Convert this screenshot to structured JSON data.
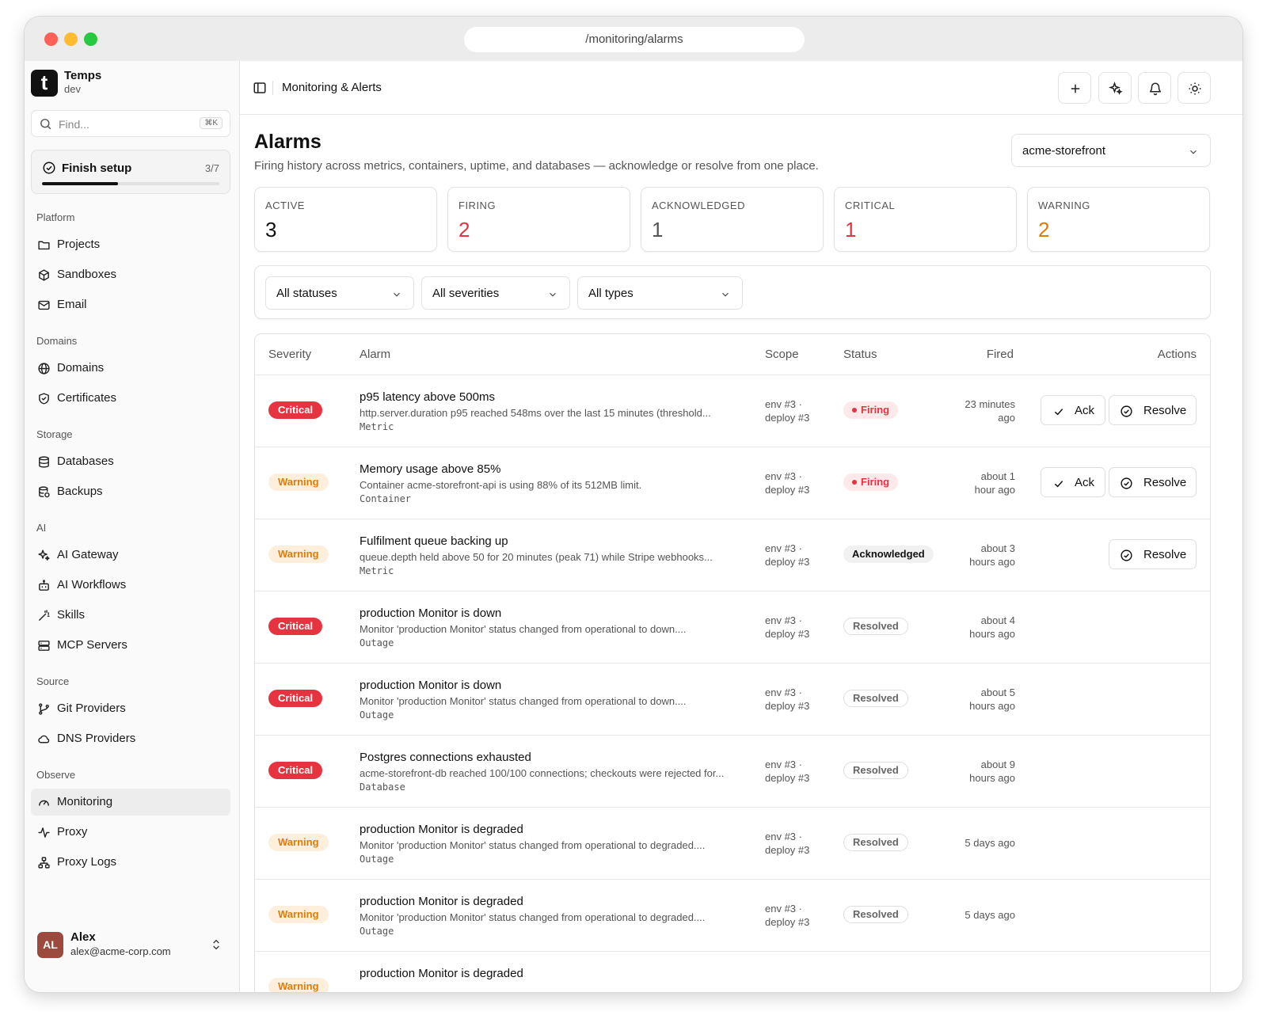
{
  "browser": {
    "url": "/monitoring/alarms"
  },
  "sidebar": {
    "brand": {
      "logo_letter": "t",
      "name": "Temps",
      "env": "dev"
    },
    "search": {
      "placeholder": "Find...",
      "shortcut": "⌘K"
    },
    "setup": {
      "label": "Finish setup",
      "count": "3/7",
      "progress": 0.43
    },
    "groups": [
      {
        "title": "Platform",
        "items": [
          {
            "label": "Projects",
            "icon": "folder-icon"
          },
          {
            "label": "Sandboxes",
            "icon": "box-icon"
          },
          {
            "label": "Email",
            "icon": "mail-icon"
          }
        ]
      },
      {
        "title": "Domains",
        "items": [
          {
            "label": "Domains",
            "icon": "globe-icon"
          },
          {
            "label": "Certificates",
            "icon": "shield-check-icon"
          }
        ]
      },
      {
        "title": "Storage",
        "items": [
          {
            "label": "Databases",
            "icon": "database-icon"
          },
          {
            "label": "Backups",
            "icon": "database-backup-icon"
          }
        ]
      },
      {
        "title": "AI",
        "items": [
          {
            "label": "AI Gateway",
            "icon": "sparkles-icon"
          },
          {
            "label": "AI Workflows",
            "icon": "bot-icon"
          },
          {
            "label": "Skills",
            "icon": "wand-icon"
          },
          {
            "label": "MCP Servers",
            "icon": "server-icon"
          }
        ]
      },
      {
        "title": "Source",
        "items": [
          {
            "label": "Git Providers",
            "icon": "git-branch-icon"
          },
          {
            "label": "DNS Providers",
            "icon": "cloud-icon"
          }
        ]
      },
      {
        "title": "Observe",
        "items": [
          {
            "label": "Monitoring",
            "icon": "gauge-icon",
            "active": true
          },
          {
            "label": "Proxy",
            "icon": "activity-icon"
          },
          {
            "label": "Proxy Logs",
            "icon": "network-icon"
          }
        ]
      }
    ],
    "user": {
      "initials": "AL",
      "name": "Alex",
      "email": "alex@acme-corp.com"
    }
  },
  "header": {
    "breadcrumb": "Monitoring & Alerts",
    "actions": [
      "plus-icon",
      "sparkles-icon",
      "bell-icon",
      "sun-icon"
    ]
  },
  "page": {
    "title": "Alarms",
    "subtitle": "Firing history across metrics, containers, uptime, and databases — acknowledge or resolve from one place.",
    "project": "acme-storefront"
  },
  "stats": [
    {
      "label": "ACTIVE",
      "value": "3",
      "color": "#111111"
    },
    {
      "label": "FIRING",
      "value": "2",
      "color": "#e5333f"
    },
    {
      "label": "ACKNOWLEDGED",
      "value": "1",
      "color": "#555555"
    },
    {
      "label": "CRITICAL",
      "value": "1",
      "color": "#e5333f"
    },
    {
      "label": "WARNING",
      "value": "2",
      "color": "#e07b0a"
    }
  ],
  "filters": {
    "status": "All statuses",
    "severity": "All severities",
    "type": "All types"
  },
  "table": {
    "columns": [
      "Severity",
      "Alarm",
      "Scope",
      "Status",
      "Fired",
      "Actions"
    ],
    "actions": {
      "ack": "Ack",
      "resolve": "Resolve"
    },
    "rows": [
      {
        "severity": "Critical",
        "sev_class": "critical",
        "title": "p95 latency above 500ms",
        "desc": "http.server.duration p95 reached 548ms over the last 15 minutes (threshold...",
        "type": "Metric",
        "scope1": "env #3 ·",
        "scope2": "deploy #3",
        "status": "Firing",
        "status_class": "firing",
        "fired1": "23 minutes",
        "fired2": "ago",
        "ack": true,
        "resolve": true
      },
      {
        "severity": "Warning",
        "sev_class": "warning",
        "title": "Memory usage above 85%",
        "desc": "Container acme-storefront-api is using 88% of its 512MB limit.",
        "type": "Container",
        "scope1": "env #3 ·",
        "scope2": "deploy #3",
        "status": "Firing",
        "status_class": "firing",
        "fired1": "about 1",
        "fired2": "hour ago",
        "ack": true,
        "resolve": true
      },
      {
        "severity": "Warning",
        "sev_class": "warning",
        "title": "Fulfilment queue backing up",
        "desc": "queue.depth held above 50 for 20 minutes (peak 71) while Stripe webhooks...",
        "type": "Metric",
        "scope1": "env #3 ·",
        "scope2": "deploy #3",
        "status": "Acknowledged",
        "status_class": "acknowledged",
        "fired1": "about 3",
        "fired2": "hours ago",
        "ack": false,
        "resolve": true
      },
      {
        "severity": "Critical",
        "sev_class": "critical",
        "title": "production Monitor is down",
        "desc": "Monitor 'production Monitor' status changed from operational to down....",
        "type": "Outage",
        "scope1": "env #3 ·",
        "scope2": "deploy #3",
        "status": "Resolved",
        "status_class": "resolved",
        "fired1": "about 4",
        "fired2": "hours ago",
        "ack": false,
        "resolve": false
      },
      {
        "severity": "Critical",
        "sev_class": "critical",
        "title": "production Monitor is down",
        "desc": "Monitor 'production Monitor' status changed from operational to down....",
        "type": "Outage",
        "scope1": "env #3 ·",
        "scope2": "deploy #3",
        "status": "Resolved",
        "status_class": "resolved",
        "fired1": "about 5",
        "fired2": "hours ago",
        "ack": false,
        "resolve": false
      },
      {
        "severity": "Critical",
        "sev_class": "critical",
        "title": "Postgres connections exhausted",
        "desc": "acme-storefront-db reached 100/100 connections; checkouts were rejected for...",
        "type": "Database",
        "scope1": "env #3 ·",
        "scope2": "deploy #3",
        "status": "Resolved",
        "status_class": "resolved",
        "fired1": "about 9",
        "fired2": "hours ago",
        "ack": false,
        "resolve": false
      },
      {
        "severity": "Warning",
        "sev_class": "warning",
        "title": "production Monitor is degraded",
        "desc": "Monitor 'production Monitor' status changed from operational to degraded....",
        "type": "Outage",
        "scope1": "env #3 ·",
        "scope2": "deploy #3",
        "status": "Resolved",
        "status_class": "resolved",
        "fired1": "5 days ago",
        "fired2": "",
        "ack": false,
        "resolve": false
      },
      {
        "severity": "Warning",
        "sev_class": "warning",
        "title": "production Monitor is degraded",
        "desc": "Monitor 'production Monitor' status changed from operational to degraded....",
        "type": "Outage",
        "scope1": "env #3 ·",
        "scope2": "deploy #3",
        "status": "Resolved",
        "status_class": "resolved",
        "fired1": "5 days ago",
        "fired2": "",
        "ack": false,
        "resolve": false
      },
      {
        "severity": "Warning",
        "sev_class": "warning",
        "title": "production Monitor is degraded",
        "desc": "",
        "type": "",
        "scope1": "",
        "scope2": "",
        "status": "",
        "status_class": "",
        "fired1": "",
        "fired2": "",
        "ack": false,
        "resolve": false
      }
    ]
  }
}
